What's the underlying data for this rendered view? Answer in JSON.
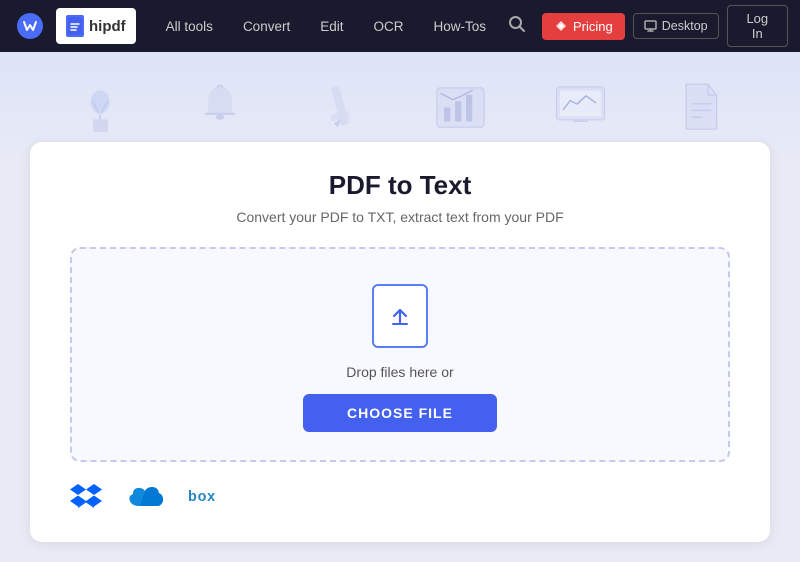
{
  "navbar": {
    "brand": "hipdf",
    "ws_brand": "wondershare",
    "links": [
      {
        "label": "All tools",
        "id": "all-tools"
      },
      {
        "label": "Convert",
        "id": "convert"
      },
      {
        "label": "Edit",
        "id": "edit"
      },
      {
        "label": "OCR",
        "id": "ocr"
      },
      {
        "label": "How-Tos",
        "id": "how-tos"
      }
    ],
    "pricing_label": "Pricing",
    "desktop_label": "Desktop",
    "login_label": "Log In"
  },
  "main": {
    "title": "PDF to Text",
    "subtitle": "Convert your PDF to TXT, extract text from your PDF",
    "drop_text": "Drop files here or",
    "choose_btn": "CHOOSE FILE"
  },
  "cloud_services": [
    {
      "name": "dropbox",
      "label": "Dropbox"
    },
    {
      "name": "onedrive",
      "label": "OneDrive"
    },
    {
      "name": "box",
      "label": "Box"
    }
  ],
  "colors": {
    "accent_blue": "#4361ee",
    "pricing_red": "#e53e3e",
    "nav_bg": "#1a1a2e"
  }
}
